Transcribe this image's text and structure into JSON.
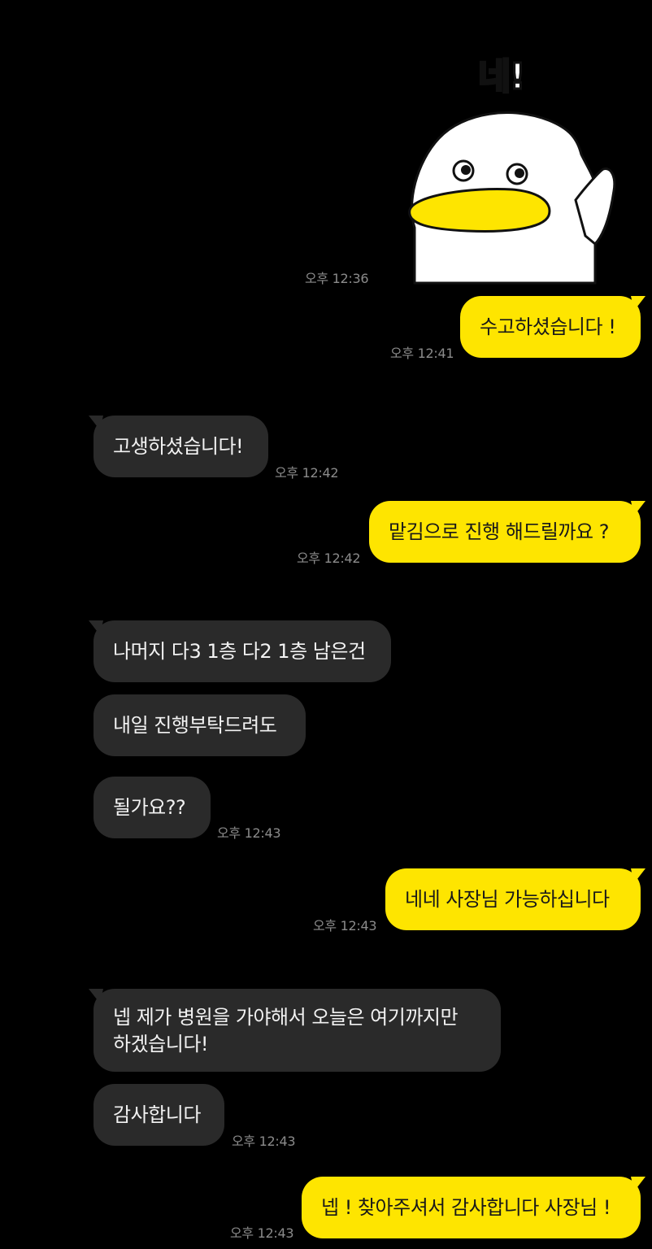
{
  "colors": {
    "background": "#000000",
    "outgoing_bubble": "#FEE500",
    "incoming_bubble": "#2a2a2a",
    "timestamp": "#8b8b8b"
  },
  "sticker": {
    "name": "duck-sticker",
    "caption": "네!",
    "time": "오후 12:36"
  },
  "messages": [
    {
      "direction": "out",
      "text": "수고하셨습니다 !",
      "time": "오후 12:41"
    },
    {
      "direction": "in",
      "text": "고생하셨습니다!",
      "time": "오후 12:42"
    },
    {
      "direction": "out",
      "text": "맡김으로 진행 해드릴까요 ?",
      "time": "오후 12:42"
    },
    {
      "direction": "in",
      "text": "나머지 다3 1층 다2 1층 남은건"
    },
    {
      "direction": "in",
      "text": "내일 진행부탁드려도"
    },
    {
      "direction": "in",
      "text": "될가요??",
      "time": "오후 12:43"
    },
    {
      "direction": "out",
      "text": "네네 사장님 가능하십니다",
      "time": "오후 12:43"
    },
    {
      "direction": "in",
      "lines": [
        "넵 제가 병원을 가야해서 오늘은 여기까지만",
        "하겠습니다!"
      ]
    },
    {
      "direction": "in",
      "text": "감사합니다",
      "time": "오후 12:43"
    },
    {
      "direction": "out",
      "text": "넵 ! 찾아주셔서 감사합니다 사장님 !",
      "time": "오후 12:43"
    }
  ]
}
